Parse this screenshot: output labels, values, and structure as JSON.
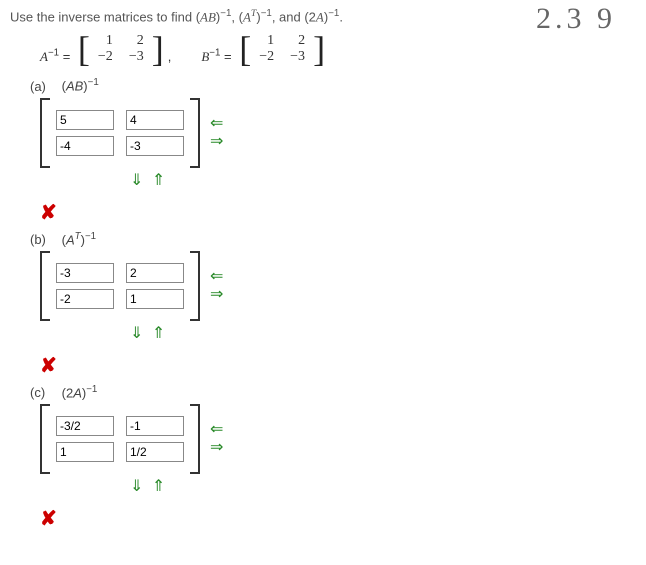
{
  "prompt": {
    "text_pre": "Use the inverse matrices to find (",
    "t1": "AB",
    "text_mid1": ")",
    "exp1": "−1",
    "text_mid2": ", (",
    "t2": "A",
    "t2sup": "T",
    "text_mid3": ")",
    "exp2": "−1",
    "text_mid4": ", and (2",
    "t3": "A",
    "text_mid5": ")",
    "exp3": "−1",
    "text_end": "."
  },
  "handwritten": "2.3  9",
  "given": {
    "A_label": "A",
    "A_exp": "−1",
    "eq": " = ",
    "A_inv": [
      [
        "1",
        "2"
      ],
      [
        "−2",
        "−3"
      ]
    ],
    "comma": ",",
    "B_label": "B",
    "B_exp": "−1",
    "B_inv": [
      [
        "1",
        "2"
      ],
      [
        "−2",
        "−3"
      ]
    ]
  },
  "parts": {
    "a": {
      "label": "(a)",
      "title_base": "AB",
      "title_exp": "−1",
      "cells": [
        "5",
        "4",
        "-4",
        "-3"
      ]
    },
    "b": {
      "label": "(b)",
      "title_base": "A",
      "title_sup": "T",
      "title_exp": "−1",
      "cells": [
        "-3",
        "2",
        "-2",
        "1"
      ]
    },
    "c": {
      "label": "(c)",
      "title_pre": "2",
      "title_base": "A",
      "title_exp": "−1",
      "cells": [
        "-3/2",
        "-1",
        "1",
        "1/2"
      ]
    }
  },
  "arrows": {
    "left": "⇐",
    "right": "⇒",
    "down": "⇓",
    "up": "⇑"
  },
  "wrong": "✘"
}
